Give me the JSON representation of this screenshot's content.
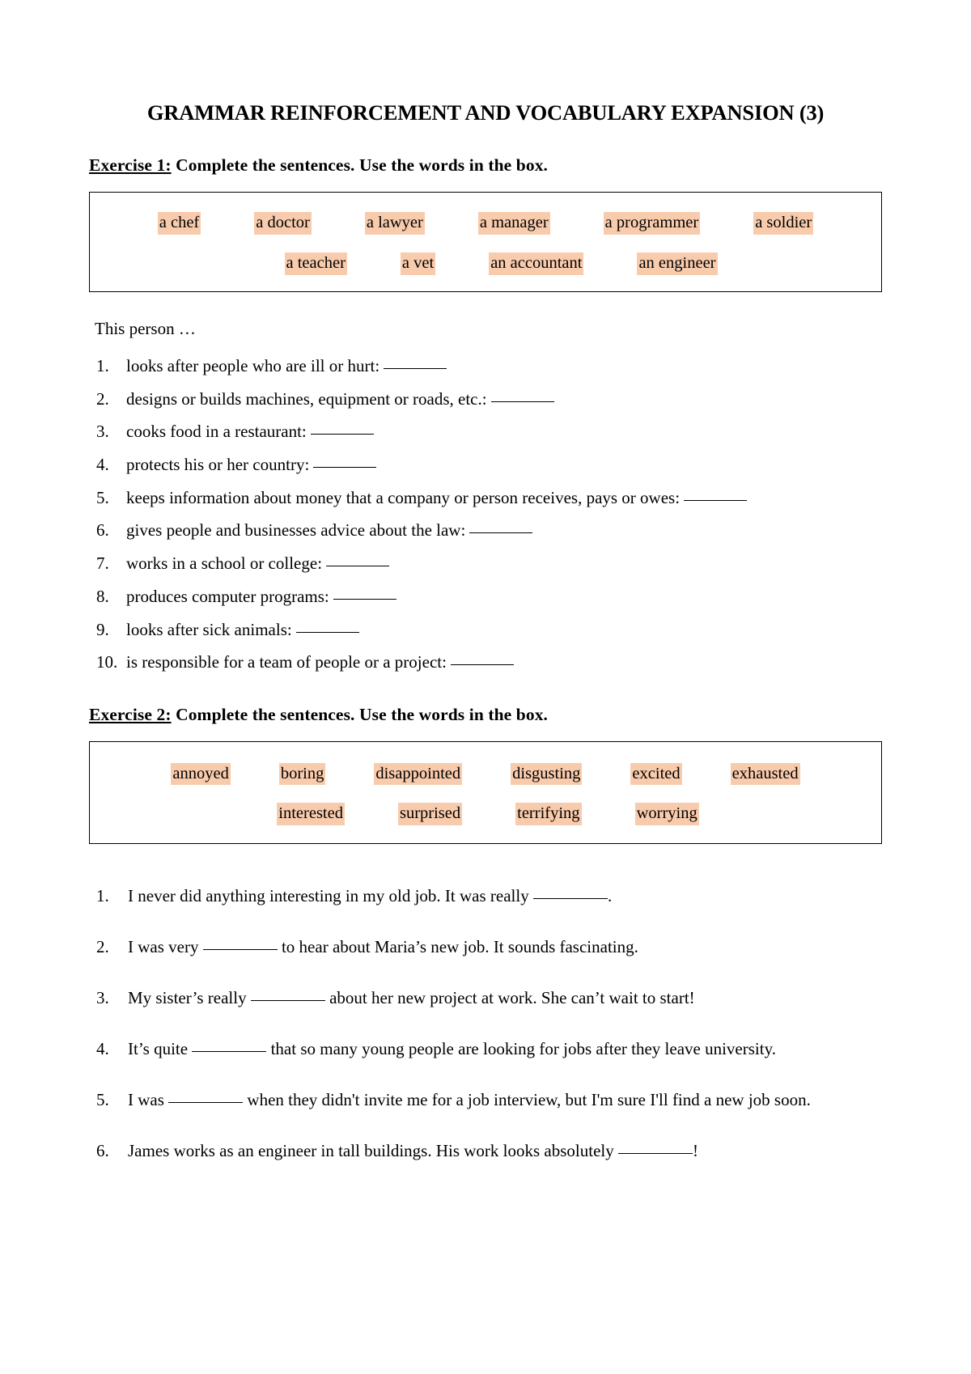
{
  "document": {
    "title": "GRAMMAR REINFORCEMENT AND VOCABULARY EXPANSION (3)",
    "highlight_color": "#F8CBAD",
    "text_color": "#000000",
    "background_color": "#FFFFFF"
  },
  "exercise1": {
    "label": "Exercise 1:",
    "instruction": " Complete the sentences. Use the words in the box.",
    "word_box": {
      "row1": [
        "a chef",
        "a doctor",
        "a lawyer",
        "a manager",
        "a programmer",
        "a soldier"
      ],
      "row2": [
        "a teacher",
        "a vet",
        "an accountant",
        "an engineer"
      ]
    },
    "intro": "This person …",
    "items": [
      {
        "num": "1.",
        "text": "looks after people who are ill or hurt:"
      },
      {
        "num": "2.",
        "text": "designs or builds machines, equipment or roads, etc.:"
      },
      {
        "num": "3.",
        "text": "cooks food in a restaurant:"
      },
      {
        "num": "4.",
        "text": "protects his or her country:"
      },
      {
        "num": "5.",
        "text": "keeps information about money that a company or person receives, pays or owes:"
      },
      {
        "num": "6.",
        "text": "gives people and businesses advice about the law:"
      },
      {
        "num": "7.",
        "text": "works in a school or college:"
      },
      {
        "num": "8.",
        "text": "produces computer programs:"
      },
      {
        "num": "9.",
        "text": "looks after sick animals:"
      },
      {
        "num": "10.",
        "text": "is responsible for a team of people or a project:"
      }
    ]
  },
  "exercise2": {
    "label": "Exercise 2:",
    "instruction": " Complete the sentences. Use the words in the box.",
    "word_box": {
      "row1": [
        "annoyed",
        "boring",
        "disappointed",
        "disgusting",
        "excited",
        "exhausted"
      ],
      "row2": [
        "interested",
        "surprised",
        "terrifying",
        "worrying"
      ]
    },
    "items": [
      {
        "num": "1.",
        "before": "I never did anything interesting in my old job. It was really ",
        "after": "."
      },
      {
        "num": "2.",
        "before": " I was very ",
        "after": " to hear about Maria’s new job. It sounds fascinating."
      },
      {
        "num": "3.",
        "before": "My sister’s really ",
        "after": " about her new project at work. She can’t wait to start!"
      },
      {
        "num": "4.",
        "before": "It’s quite ",
        "after": " that so many young people are looking for jobs after they leave university."
      },
      {
        "num": "5.",
        "before": " I was ",
        "after": " when they didn't invite me for a job interview, but I'm sure I'll find a new job soon."
      },
      {
        "num": "6.",
        "before": "James works as an engineer in tall buildings. His work looks absolutely ",
        "after": "!"
      }
    ]
  }
}
